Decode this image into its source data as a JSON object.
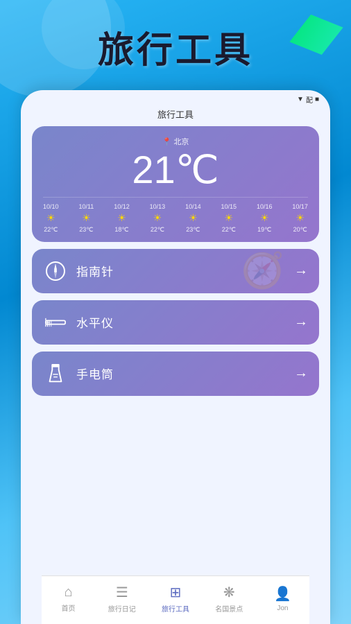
{
  "app": {
    "title": "旅行工具",
    "background_gradient_start": "#29b6f6",
    "background_gradient_end": "#4fc3f7"
  },
  "phone": {
    "header_title": "旅行工具",
    "status_signal": "▼",
    "status_battery": "■"
  },
  "weather": {
    "location_icon": "📍",
    "location": "北京",
    "temperature": "21℃",
    "forecast": [
      {
        "date": "10/10",
        "icon": "☀",
        "temp": "22℃"
      },
      {
        "date": "10/11",
        "icon": "☀",
        "temp": "23℃"
      },
      {
        "date": "10/12",
        "icon": "☀",
        "temp": "18℃"
      },
      {
        "date": "10/13",
        "icon": "☀",
        "temp": "22℃"
      },
      {
        "date": "10/14",
        "icon": "☀",
        "temp": "23℃"
      },
      {
        "date": "10/15",
        "icon": "☀",
        "temp": "22℃"
      },
      {
        "date": "10/16",
        "icon": "☀",
        "temp": "19℃"
      },
      {
        "date": "10/17",
        "icon": "☀",
        "temp": "20℃"
      }
    ]
  },
  "tools": [
    {
      "id": "compass",
      "name": "指南针",
      "arrow": "→"
    },
    {
      "id": "level",
      "name": "水平仪",
      "arrow": "→"
    },
    {
      "id": "flashlight",
      "name": "手电筒",
      "arrow": "→"
    }
  ],
  "nav": {
    "items": [
      {
        "id": "home",
        "label": "首页",
        "active": false
      },
      {
        "id": "diary",
        "label": "旅行日记",
        "active": false
      },
      {
        "id": "tools",
        "label": "旅行工具",
        "active": true
      },
      {
        "id": "spots",
        "label": "名国景点",
        "active": false
      },
      {
        "id": "profile",
        "label": "Jon",
        "active": false
      }
    ]
  }
}
